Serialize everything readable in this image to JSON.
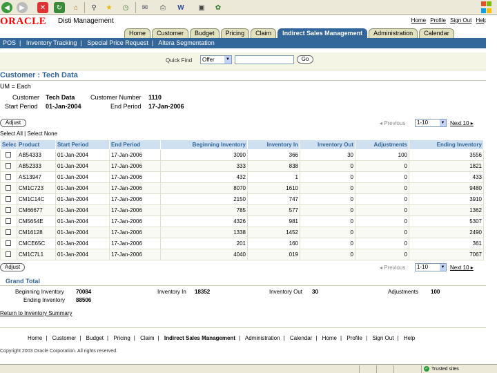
{
  "browser": {
    "icons": [
      "back-icon",
      "forward-icon",
      "stop-icon",
      "refresh-icon",
      "home-icon",
      "search-icon",
      "favorites-icon",
      "history-icon",
      "mail-icon",
      "print-icon",
      "edit-icon",
      "discuss-icon",
      "messenger-icon"
    ]
  },
  "brand": {
    "logo": "ORACLE",
    "app_name": "Disti Management",
    "global_links": [
      "Home",
      "Profile",
      "Sign Out",
      "Help"
    ]
  },
  "tabs": [
    {
      "label": "Home",
      "active": false
    },
    {
      "label": "Customer",
      "active": false
    },
    {
      "label": "Budget",
      "active": false
    },
    {
      "label": "Pricing",
      "active": false
    },
    {
      "label": "Claim",
      "active": false
    },
    {
      "label": "Indirect Sales Management",
      "active": true
    },
    {
      "label": "Administration",
      "active": false
    },
    {
      "label": "Calendar",
      "active": false
    }
  ],
  "subnav": [
    "POS",
    "Inventory Tracking",
    "Special Price Request",
    "Altera Segmentation"
  ],
  "quickfind": {
    "label": "Quick Find",
    "selected": "Offer",
    "input_value": "",
    "go_label": "Go"
  },
  "page": {
    "title": "Customer : Tech Data",
    "uom": "UM = Each",
    "customer_label": "Customer",
    "customer_value": "Tech Data",
    "customer_number_label": "Customer Number",
    "customer_number_value": "1110",
    "start_period_label": "Start Period",
    "start_period_value": "01-Jan-2004",
    "end_period_label": "End Period",
    "end_period_value": "17-Jan-2006"
  },
  "actions": {
    "adjust_label": "Adjust",
    "select_all": "Select All",
    "select_none": "Select None",
    "previous": "Previous",
    "range": "1-10",
    "next": "Next 10"
  },
  "table": {
    "columns": [
      "Select",
      "Product",
      "Start Period",
      "End Period",
      "Beginning Inventory",
      "Inventory In",
      "Inventory Out",
      "Adjustments",
      "Ending Inventory"
    ],
    "rows": [
      [
        "AB54333",
        "01-Jan-2004",
        "17-Jan-2006",
        "3090",
        "366",
        "30",
        "100",
        "3556"
      ],
      [
        "AB52333",
        "01-Jan-2004",
        "17-Jan-2006",
        "333",
        "838",
        "0",
        "0",
        "1821"
      ],
      [
        "AS13947",
        "01-Jan-2004",
        "17-Jan-2006",
        "432",
        "1",
        "0",
        "0",
        "433"
      ],
      [
        "CM1C723",
        "01-Jan-2004",
        "17-Jan-2006",
        "8070",
        "1610",
        "0",
        "0",
        "9480"
      ],
      [
        "CM1C14C",
        "01-Jan-2004",
        "17-Jan-2006",
        "2150",
        "747",
        "0",
        "0",
        "3910"
      ],
      [
        "CM66677",
        "01-Jan-2004",
        "17-Jan-2006",
        "785",
        "577",
        "0",
        "0",
        "1362"
      ],
      [
        "CM5654E",
        "01-Jan-2004",
        "17-Jan-2006",
        "4326",
        "981",
        "0",
        "0",
        "5307"
      ],
      [
        "CM16128",
        "01-Jan-2004",
        "17-Jan-2006",
        "1338",
        "1452",
        "0",
        "0",
        "2490"
      ],
      [
        "CMCE65C",
        "01-Jan-2004",
        "17-Jan-2006",
        "201",
        "160",
        "0",
        "0",
        "361"
      ],
      [
        "CM1C7L1",
        "01-Jan-2004",
        "17-Jan-2006",
        "4040",
        "019",
        "0",
        "0",
        "7067"
      ]
    ]
  },
  "grand_total": {
    "title": "Grand Total",
    "beginning_label": "Beginning Inventory",
    "beginning_value": "70084",
    "inventory_in_label": "Inventory In",
    "inventory_in_value": "18352",
    "inventory_out_label": "Inventory Out",
    "inventory_out_value": "30",
    "adjustments_label": "Adjustments",
    "adjustments_value": "100",
    "ending_label": "Ending Inventory",
    "ending_value": "88506"
  },
  "return_link": "Return to Inventory Summary",
  "footer": {
    "links": [
      "Home",
      "Customer",
      "Budget",
      "Pricing",
      "Claim",
      "Indirect Sales Management",
      "Administration",
      "Calendar",
      "Home",
      "Profile",
      "Sign Out",
      "Help"
    ],
    "current": "Indirect Sales Management",
    "copyright": "Copyright 2003 Oracle Corporation. All rights reserved."
  },
  "statusbar": {
    "zone": "Trusted sites"
  },
  "colors": {
    "brand_red": "#ff0000",
    "nav_blue": "#336699",
    "header_bg": "#cfe0f1",
    "tab_bg": "#e1e1c0"
  }
}
